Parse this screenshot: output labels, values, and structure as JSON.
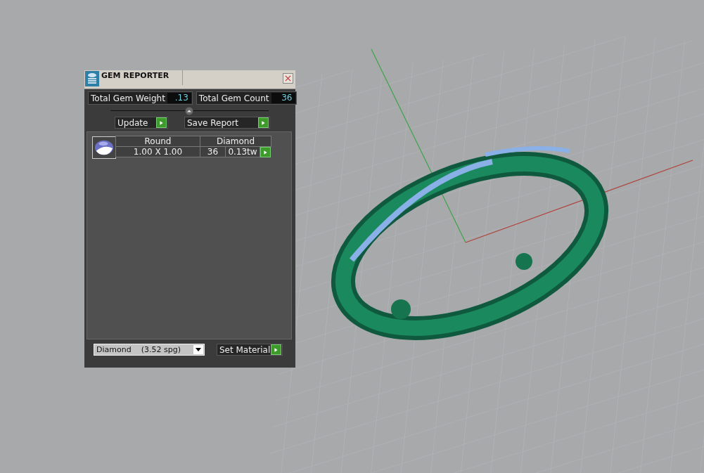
{
  "window": {
    "title": "GEM REPORTER"
  },
  "totals": [
    {
      "label": "Total Gem Weight",
      "value": ".13"
    },
    {
      "label": "Total Gem Count",
      "value": "36"
    }
  ],
  "buttons": [
    "Update",
    "Save Report"
  ],
  "gems": [
    {
      "shape": "Round",
      "material": "Diamond",
      "size": "1.00 X 1.00",
      "count": "36",
      "weight": "0.13tw"
    }
  ],
  "material_select": {
    "value": "Diamond    (3.52 spg)"
  },
  "set_button": "Set Material"
}
